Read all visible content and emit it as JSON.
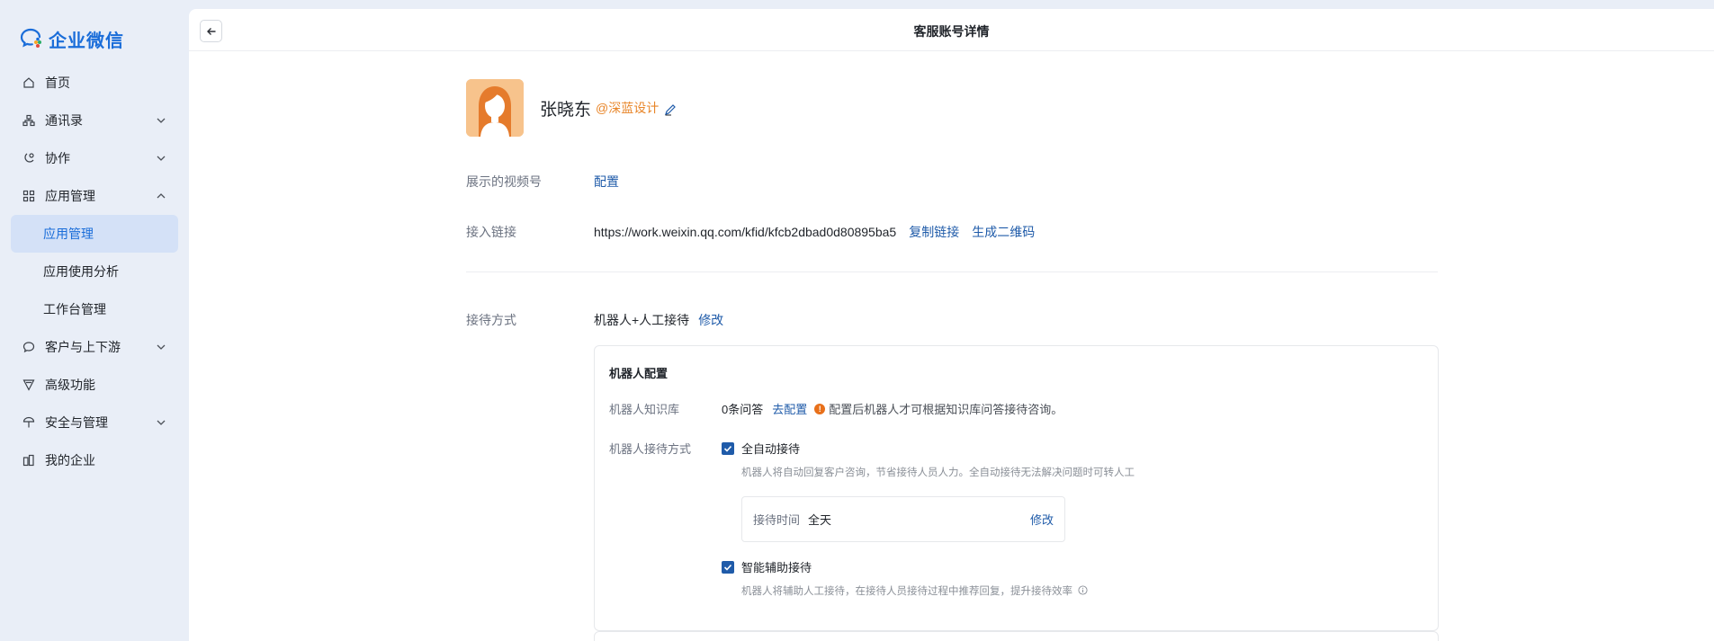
{
  "app": {
    "name": "企业微信"
  },
  "nav": {
    "items": [
      {
        "label": "首页",
        "icon": "home-icon",
        "expand": ""
      },
      {
        "label": "通讯录",
        "icon": "contacts-icon",
        "expand": "down"
      },
      {
        "label": "协作",
        "icon": "collab-icon",
        "expand": "down"
      },
      {
        "label": "应用管理",
        "icon": "apps-icon",
        "expand": "up"
      }
    ],
    "sub": [
      {
        "label": "应用管理",
        "active": true
      },
      {
        "label": "应用使用分析",
        "active": false
      },
      {
        "label": "工作台管理",
        "active": false
      }
    ],
    "items2": [
      {
        "label": "客户与上下游",
        "icon": "chat-icon",
        "expand": "down"
      },
      {
        "label": "高级功能",
        "icon": "advanced-icon",
        "expand": ""
      },
      {
        "label": "安全与管理",
        "icon": "security-icon",
        "expand": "down"
      },
      {
        "label": "我的企业",
        "icon": "building-icon",
        "expand": ""
      }
    ]
  },
  "page": {
    "title": "客服账号详情"
  },
  "profile": {
    "name": "张晓东",
    "corp": "@深蓝设计"
  },
  "channels": {
    "label": "展示的视频号",
    "action": "配置"
  },
  "access": {
    "label": "接入链接",
    "url": "https://work.weixin.qq.com/kfid/kfcb2dbad0d80895ba5",
    "copy": "复制链接",
    "qr": "生成二维码"
  },
  "reception": {
    "label": "接待方式",
    "value": "机器人+人工接待",
    "edit": "修改"
  },
  "robot": {
    "title": "机器人配置",
    "kb_label": "机器人知识库",
    "kb_value": "0条问答",
    "kb_action": "去配置",
    "kb_hint": "配置后机器人才可根据知识库问答接待咨询。",
    "mode_label": "机器人接待方式",
    "auto_label": "全自动接待",
    "auto_checked": true,
    "auto_desc": "机器人将自动回复客户咨询，节省接待人员人力。全自动接待无法解决问题时可转人工",
    "time_label": "接待时间",
    "time_value": "全天",
    "time_edit": "修改",
    "assist_label": "智能辅助接待",
    "assist_checked": true,
    "assist_desc": "机器人将辅助人工接待，在接待人员接待过程中推荐回复，提升接待效率"
  }
}
